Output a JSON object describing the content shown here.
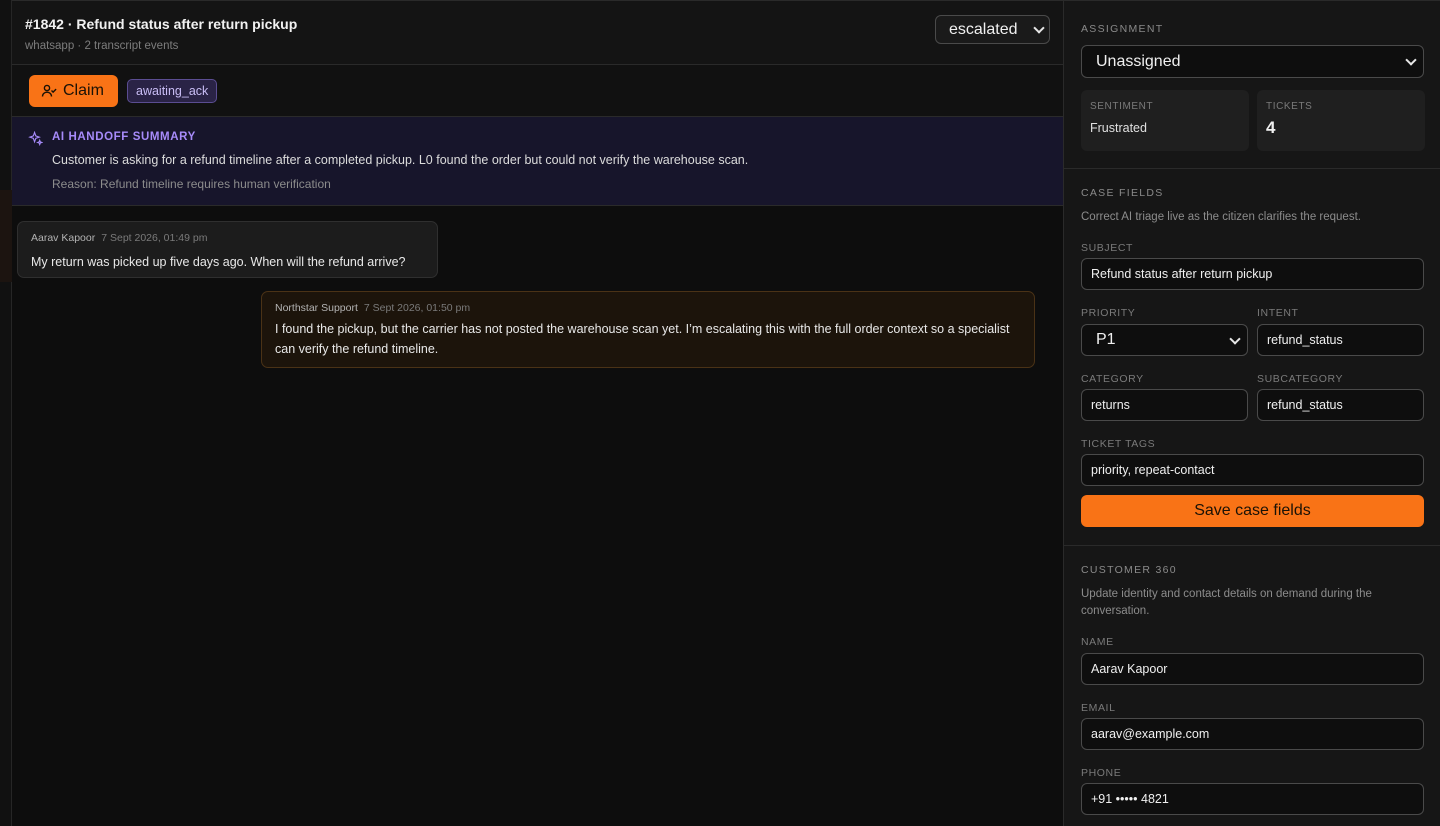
{
  "ticket": {
    "title": "#1842 · Refund status after return pickup",
    "subtitle": "whatsapp · 2 transcript events",
    "status": "escalated"
  },
  "actions": {
    "claim_label": "Claim",
    "state_badge": "awaiting_ack"
  },
  "summary": {
    "title": "AI HANDOFF SUMMARY",
    "text": "Customer is asking for a refund timeline after a completed pickup. L0 found the order but could not verify the warehouse scan.",
    "reason": "Reason: Refund timeline requires human verification"
  },
  "messages": [
    {
      "author": "Aarav Kapoor",
      "time": "7 Sept 2026, 01:49 pm",
      "text": "My return was picked up five days ago. When will the refund arrive?"
    },
    {
      "author": "Northstar Support",
      "time": "7 Sept 2026, 01:50 pm",
      "text": "I found the pickup, but the carrier has not posted the warehouse scan yet. I’m escalating this with the full order context so a specialist can verify the refund timeline."
    }
  ],
  "sidebar": {
    "assignment": {
      "label": "ASSIGNMENT",
      "value": "Unassigned"
    },
    "sentiment": {
      "label": "SENTIMENT",
      "value": "Frustrated"
    },
    "tickets": {
      "label": "TICKETS",
      "value": "4"
    },
    "case_fields": {
      "label": "CASE FIELDS",
      "help": "Correct AI triage live as the citizen clarifies the request.",
      "subject_label": "SUBJECT",
      "subject": "Refund status after return pickup",
      "priority_label": "PRIORITY",
      "priority": "P1",
      "intent_label": "INTENT",
      "intent": "refund_status",
      "category_label": "CATEGORY",
      "category": "returns",
      "subcategory_label": "SUBCATEGORY",
      "subcategory": "refund_status",
      "tags_label": "TICKET TAGS",
      "tags": "priority, repeat-contact",
      "save_label": "Save case fields"
    },
    "customer": {
      "label": "CUSTOMER 360",
      "help_line1": "Update identity and contact details on demand during the",
      "help_line2": "conversation.",
      "name_label": "NAME",
      "name": "Aarav Kapoor",
      "email_label": "EMAIL",
      "email": "aarav@example.com",
      "phone_label": "PHONE",
      "phone": "+91 ••••• 4821"
    }
  },
  "colors": {
    "accent": "#f97316",
    "ai_purple": "#a78bfa"
  }
}
